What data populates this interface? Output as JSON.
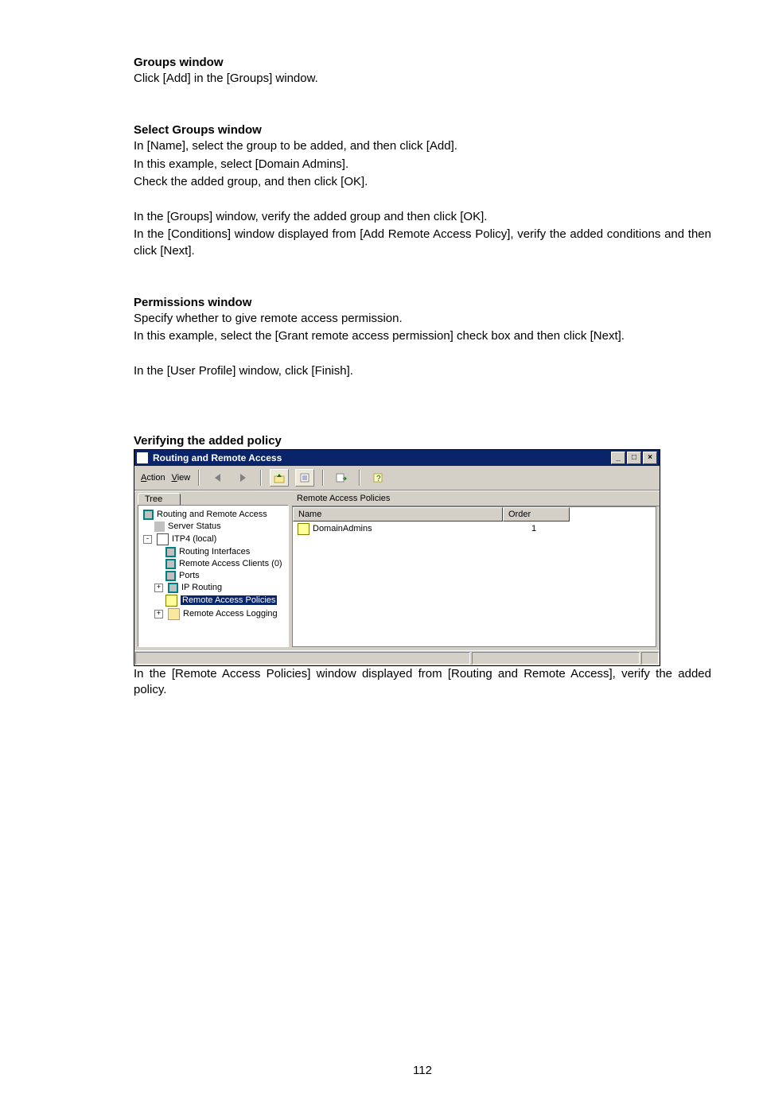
{
  "sections": {
    "groups": {
      "title": "Groups window",
      "p1": "Click [Add] in the [Groups] window."
    },
    "select_groups": {
      "title": "Select Groups window",
      "p1": "In [Name], select the group to be added, and then click [Add].",
      "p2": "In this example, select [Domain Admins].",
      "p3": "Check the added group, and then click [OK].",
      "p4": "In the [Groups] window, verify the added group and then click [OK].",
      "p5": "In the [Conditions] window displayed from [Add Remote Access Policy], verify the added conditions and then click [Next]."
    },
    "permissions": {
      "title": "Permissions window",
      "p1": "Specify whether to give remote access permission.",
      "p2": "In this example, select the [Grant remote access permission] check box and then click [Next].",
      "p3": "In the [User Profile] window, click [Finish]."
    },
    "verifying": {
      "title": "Verifying the added policy",
      "caption": "In the [Remote Access Policies] window displayed from [Routing and Remote Access], verify the added policy."
    }
  },
  "window": {
    "title": "Routing and Remote Access",
    "menu": {
      "action": "Action",
      "view": "View"
    },
    "left_tab": "Tree",
    "right_header": "Remote Access Policies",
    "columns": {
      "name": "Name",
      "order": "Order"
    },
    "row": {
      "name": "DomainAdmins",
      "order": "1"
    },
    "tree": {
      "root": "Routing and Remote Access",
      "server_status": "Server Status",
      "local": "ITP4 (local)",
      "routing_ifaces": "Routing Interfaces",
      "ra_clients": "Remote Access Clients (0)",
      "ports": "Ports",
      "ip_routing": "IP Routing",
      "ra_policies": "Remote Access Policies",
      "ra_logging": "Remote Access Logging"
    }
  },
  "page_number": "112"
}
